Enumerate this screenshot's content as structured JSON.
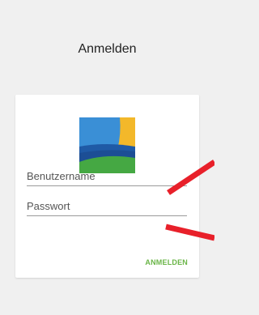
{
  "page": {
    "title": "Anmelden"
  },
  "login_form": {
    "username_placeholder": "Benutzername",
    "password_placeholder": "Passwort",
    "submit_label": "ANMELDEN"
  },
  "colors": {
    "background": "#f0f0f0",
    "card": "#ffffff",
    "accent_green": "#6ab547",
    "annotation_arrow": "#e8202a",
    "logo_sky": "#3a8fd6",
    "logo_sun": "#f3b82a",
    "logo_sea": "#1f5aa6",
    "logo_land": "#45a843"
  },
  "icons": {
    "logo": "landscape-logo",
    "annotations": "red-arrow"
  }
}
